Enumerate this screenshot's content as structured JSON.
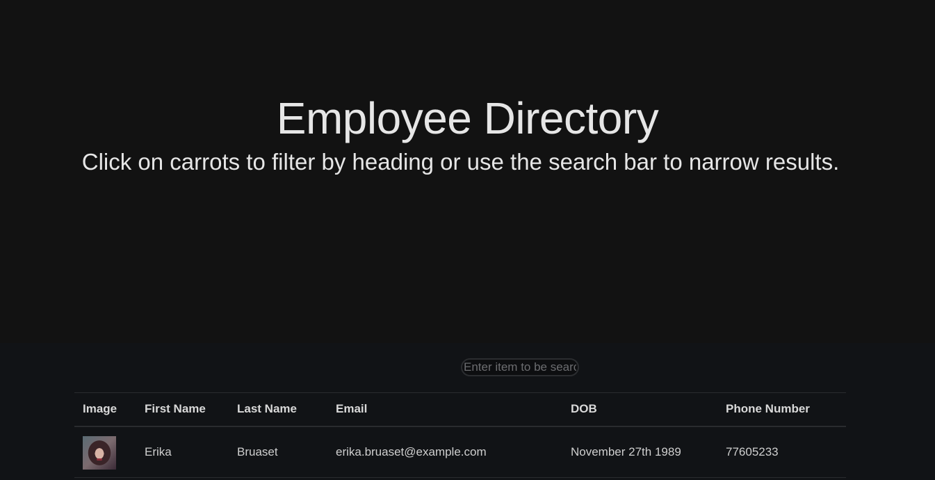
{
  "header": {
    "title": "Employee Directory",
    "subtitle": "Click on carrots to filter by heading or use the search bar to narrow results."
  },
  "search": {
    "placeholder": "Enter item to be search",
    "value": ""
  },
  "table": {
    "columns": [
      "Image",
      "First Name",
      "Last Name",
      "Email",
      "DOB",
      "Phone Number"
    ],
    "rows": [
      {
        "image": "employee-photo",
        "first_name": "Erika",
        "last_name": "Bruaset",
        "email": "erika.bruaset@example.com",
        "dob": "November 27th 1989",
        "phone": "77605233"
      }
    ]
  },
  "colors": {
    "hero_background": "#121212",
    "content_background": "#111316",
    "text": "#e6e6e6",
    "border": "#2a2c2f"
  }
}
